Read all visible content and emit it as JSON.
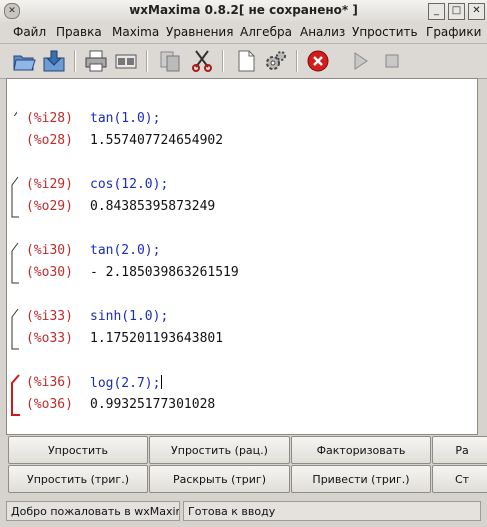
{
  "window": {
    "title": "wxMaxima 0.8.2[ не сохранено* ]",
    "minimize": "_",
    "maximize": "□",
    "close": "✕"
  },
  "menubar": [
    "Файл",
    "Правка",
    "Maxima",
    "Уравнения",
    "Алгебра",
    "Анализ",
    "Упростить",
    "Графики"
  ],
  "toolbar": {
    "icons": [
      "open-icon",
      "save-icon",
      "print-icon",
      "preferences-icon",
      "copy-icon",
      "cut-icon",
      "new-document-icon",
      "settings-icon",
      "interrupt-icon",
      "play-icon",
      "stop-icon"
    ]
  },
  "cells": [
    {
      "in_label": "(%i28)",
      "input": "tan(1.0);",
      "out_label": "(%o28)",
      "output": "1.557407724654902"
    },
    {
      "in_label": "(%i29)",
      "input": "cos(12.0);",
      "out_label": "(%o29)",
      "output": "0.84385395873249"
    },
    {
      "in_label": "(%i30)",
      "input": "tan(2.0);",
      "out_label": "(%o30)",
      "output": "- 2.185039863261519"
    },
    {
      "in_label": "(%i33)",
      "input": "sinh(1.0);",
      "out_label": "(%o33)",
      "output": "1.175201193643801"
    },
    {
      "in_label": "(%i36)",
      "input": "log(2.7);",
      "out_label": "(%o36)",
      "output": "0.99325177301028"
    }
  ],
  "buttons": {
    "row1": [
      "Упростить",
      "Упростить (рац.)",
      "Факторизовать",
      "Ра"
    ],
    "row2": [
      "Упростить (триг.)",
      "Раскрыть (триг)",
      "Привести (триг.)",
      "Ст"
    ]
  },
  "status": {
    "welcome": "Добро пожаловать в wxMaxima",
    "state": "Готова к вводу"
  },
  "colors": {
    "label": "#c02b2b",
    "input": "#1a2dbb",
    "active_bracket": "#d01818"
  }
}
